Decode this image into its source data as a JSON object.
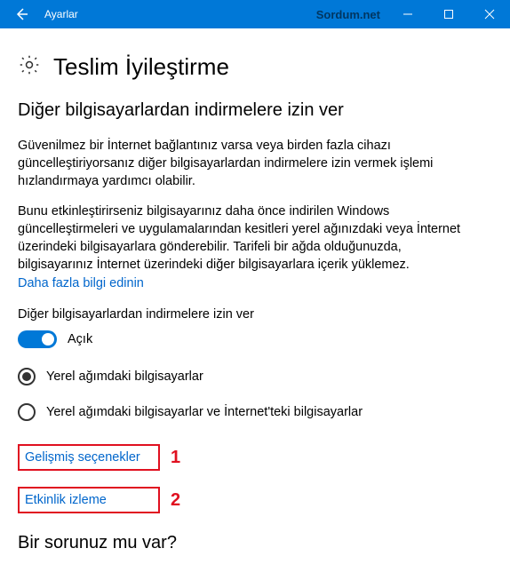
{
  "titlebar": {
    "title": "Ayarlar",
    "watermark": "Sordum.net"
  },
  "page": {
    "heading": "Teslim İyileştirme",
    "section_title": "Diğer bilgisayarlardan indirmelere izin ver",
    "para1": "Güvenilmez bir İnternet bağlantınız varsa veya birden fazla cihazı güncelleştiriyorsanız diğer bilgisayarlardan indirmelere izin vermek işlemi hızlandırmaya yardımcı olabilir.",
    "para2": "Bunu etkinleştirirseniz bilgisayarınız daha önce indirilen Windows güncelleştirmeleri ve uygulamalarından kesitleri yerel ağınızdaki veya İnternet üzerindeki bilgisayarlara gönderebilir. Tarifeli bir ağda olduğunuzda, bilgisayarınız İnternet üzerindeki diğer bilgisayarlara içerik yüklemez.",
    "learn_more": "Daha fazla bilgi edinin",
    "subheading": "Diğer bilgisayarlardan indirmelere izin ver",
    "toggle_label": "Açık",
    "radio1": "Yerel ağımdaki bilgisayarlar",
    "radio2": "Yerel ağımdaki bilgisayarlar ve İnternet'teki bilgisayarlar",
    "adv_options": "Gelişmiş seçenekler",
    "activity_monitor": "Etkinlik izleme",
    "annot1": "1",
    "annot2": "2",
    "question": "Bir sorunuz mu var?"
  }
}
